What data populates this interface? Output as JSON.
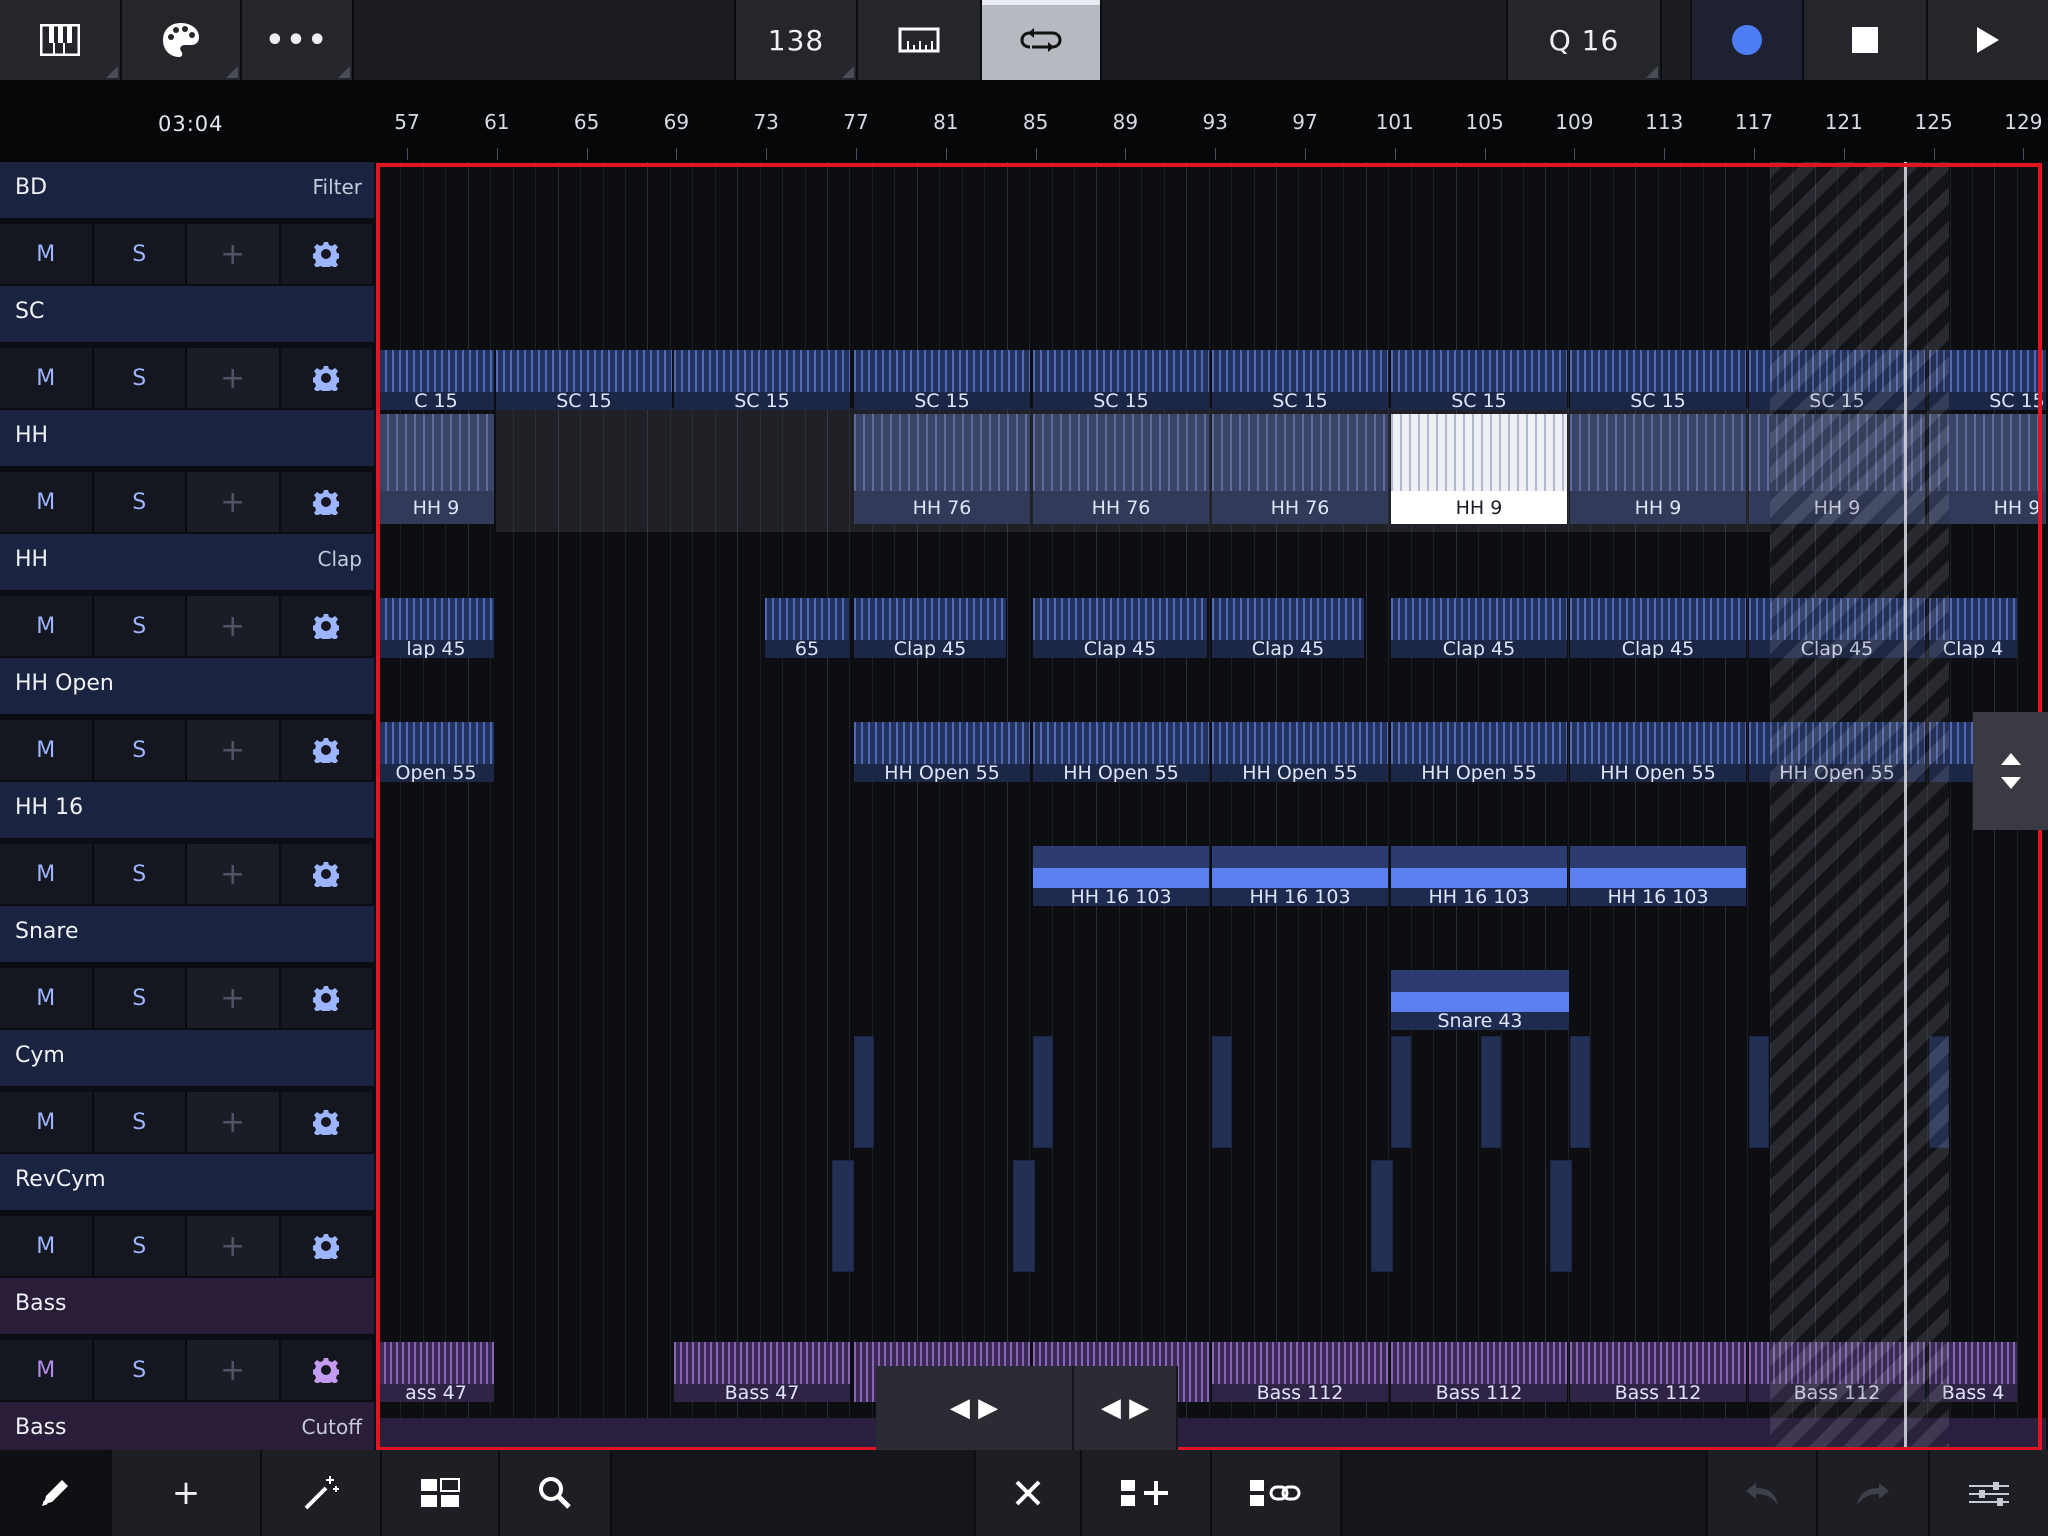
{
  "toolbar": {
    "tempo": "138",
    "quantize": "Q 16",
    "buttons": [
      "piano-roll",
      "palette",
      "more",
      "tempo",
      "metronome",
      "loop",
      "quantize",
      "record",
      "stop",
      "play"
    ]
  },
  "timeline": {
    "timecode": "03:04",
    "bars": [
      "57",
      "61",
      "65",
      "69",
      "73",
      "77",
      "81",
      "85",
      "89",
      "93",
      "97",
      "101",
      "105",
      "109",
      "113",
      "117",
      "121",
      "125",
      "129"
    ]
  },
  "tracks": [
    {
      "name": "BD",
      "param": "Filter",
      "color": "blue"
    },
    {
      "name": "SC",
      "param": "",
      "color": "blue"
    },
    {
      "name": "HH",
      "param": "",
      "color": "blue"
    },
    {
      "name": "HH",
      "param": "Clap",
      "color": "blue"
    },
    {
      "name": "HH Open",
      "param": "",
      "color": "blue"
    },
    {
      "name": "HH 16",
      "param": "",
      "color": "blue"
    },
    {
      "name": "Snare",
      "param": "",
      "color": "blue"
    },
    {
      "name": "Cym",
      "param": "",
      "color": "blue"
    },
    {
      "name": "RevCym",
      "param": "",
      "color": "blue"
    },
    {
      "name": "Bass",
      "param": "",
      "color": "purple"
    },
    {
      "name": "Bass",
      "param": "Cutoff",
      "color": "purple"
    }
  ],
  "track_controls": {
    "mute": "M",
    "solo": "S",
    "add": "+"
  },
  "clips": {
    "sc": [
      "C  15",
      "SC  15",
      "SC  15",
      "SC  15",
      "SC  15",
      "SC  15",
      "SC  15",
      "SC  15",
      "SC  15",
      "SC  15"
    ],
    "hh": [
      "HH  9",
      "HH  76",
      "HH  76",
      "HH  76",
      "HH  9",
      "HH  9",
      "HH  9",
      "HH  9"
    ],
    "clap": [
      "lap  45",
      "65",
      "Clap  45",
      "Clap  45",
      "Clap  45",
      "Clap  45",
      "Clap  45",
      "Clap  45",
      "Clap  4"
    ],
    "hhopen": [
      "Open  55",
      "HH Open  55",
      "HH Open  55",
      "HH Open  55",
      "HH Open  55",
      "HH Open  55",
      "HH Open  55",
      "H"
    ],
    "hh16": [
      "HH 16 103",
      "HH 16 103",
      "HH 16 103",
      "HH 16 103"
    ],
    "snare": [
      "Snare  43"
    ],
    "bass": [
      "ass  47",
      "Bass  47",
      "Bass  112",
      "Bass  112",
      "Bass  112",
      "Bass  112",
      "Bass  4"
    ]
  },
  "colors": {
    "selection": "#e0151d",
    "record": "#4d7cf5",
    "accent_blue": "#5d80f0",
    "accent_purple": "#b48be8"
  }
}
